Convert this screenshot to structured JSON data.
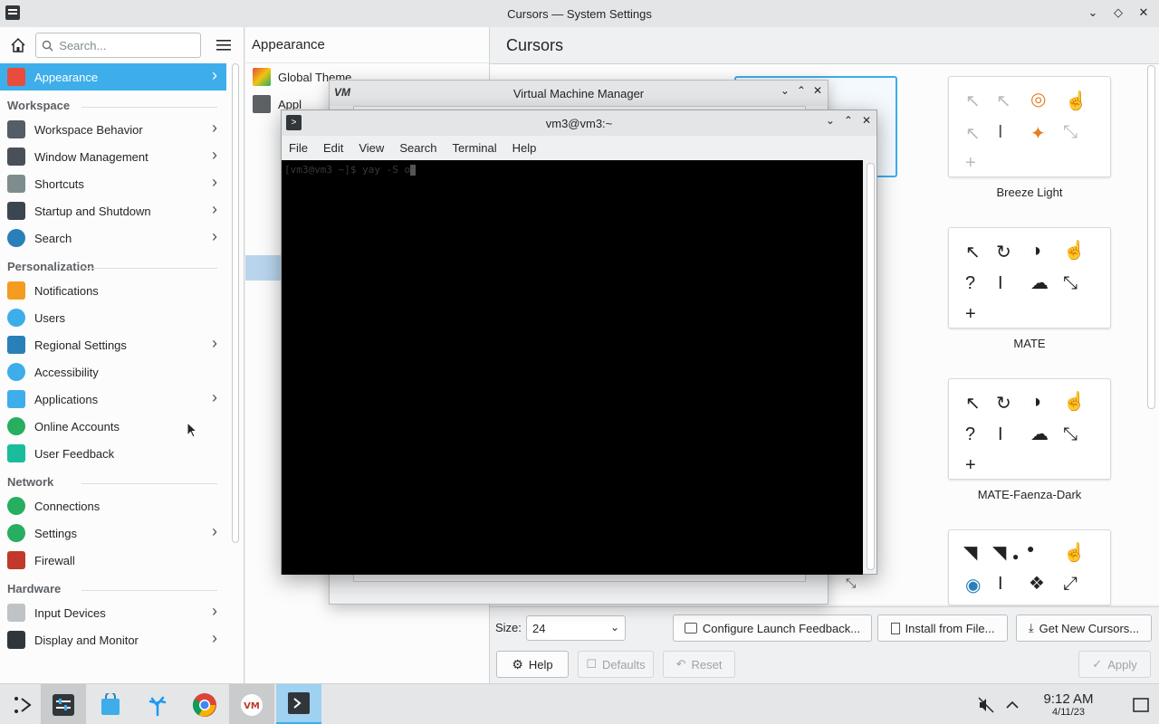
{
  "window": {
    "title": "Cursors — System Settings",
    "controls": [
      "chevron-down",
      "diamond",
      "close"
    ]
  },
  "sidebar": {
    "search_placeholder": "Search...",
    "active_item": "Appearance",
    "sections": [
      {
        "title": "",
        "items": [
          {
            "label": "Appearance",
            "icon": "appearance-icon",
            "color": "#e74c3c",
            "chevron": true
          }
        ]
      },
      {
        "title": "Workspace",
        "items": [
          {
            "label": "Workspace Behavior",
            "icon": "workspace-icon",
            "color": "#555d66",
            "chevron": true
          },
          {
            "label": "Window Management",
            "icon": "window-icon",
            "color": "#4a5058",
            "chevron": true
          },
          {
            "label": "Shortcuts",
            "icon": "keyboard-icon",
            "color": "#7f8c8d",
            "chevron": true
          },
          {
            "label": "Startup and Shutdown",
            "icon": "startup-icon",
            "color": "#3c4650",
            "chevron": true
          },
          {
            "label": "Search",
            "icon": "search-icon",
            "color": "#2980b9",
            "chevron": true
          }
        ]
      },
      {
        "title": "Personalization",
        "items": [
          {
            "label": "Notifications",
            "icon": "bell-icon",
            "color": "#f39c1f",
            "chevron": false
          },
          {
            "label": "Users",
            "icon": "users-icon",
            "color": "#3daee9",
            "chevron": false
          },
          {
            "label": "Regional Settings",
            "icon": "regional-icon",
            "color": "#2980b9",
            "chevron": true
          },
          {
            "label": "Accessibility",
            "icon": "accessibility-icon",
            "color": "#3daee9",
            "chevron": false
          },
          {
            "label": "Applications",
            "icon": "applications-icon",
            "color": "#3daee9",
            "chevron": true
          },
          {
            "label": "Online Accounts",
            "icon": "online-accounts-icon",
            "color": "#27ae60",
            "chevron": false
          },
          {
            "label": "User Feedback",
            "icon": "feedback-icon",
            "color": "#1abc9c",
            "chevron": false
          }
        ]
      },
      {
        "title": "Network",
        "items": [
          {
            "label": "Connections",
            "icon": "globe-icon",
            "color": "#27ae60",
            "chevron": false
          },
          {
            "label": "Settings",
            "icon": "globe-settings-icon",
            "color": "#27ae60",
            "chevron": true
          },
          {
            "label": "Firewall",
            "icon": "firewall-icon",
            "color": "#c0392b",
            "chevron": false
          }
        ]
      },
      {
        "title": "Hardware",
        "items": [
          {
            "label": "Input Devices",
            "icon": "mouse-icon",
            "color": "#bdc3c7",
            "chevron": true
          },
          {
            "label": "Display and Monitor",
            "icon": "monitor-icon",
            "color": "#31363b",
            "chevron": true
          }
        ]
      }
    ]
  },
  "middle": {
    "header": "Appearance",
    "items": [
      {
        "label": "Global Theme",
        "icon": "global-theme-icon"
      },
      {
        "label": "Appl",
        "icon": "application-style-icon"
      }
    ]
  },
  "right": {
    "header": "Cursors",
    "themes": [
      {
        "name": "Breeze Light",
        "style": "light"
      },
      {
        "name": "MATE",
        "style": "dark"
      },
      {
        "name": "MATE-Faenza-Dark",
        "style": "dark"
      },
      {
        "name": "",
        "style": "dark"
      }
    ],
    "size_label": "Size:",
    "size_value": "24",
    "buttons": {
      "configure": "Configure Launch Feedback...",
      "install": "Install from File...",
      "get_new": "Get New Cursors...",
      "help": "Help",
      "defaults": "Defaults",
      "reset": "Reset",
      "apply": "Apply"
    }
  },
  "vmm": {
    "title": "Virtual Machine Manager",
    "icon_text": "VM"
  },
  "terminal": {
    "title": "vm3@vm3:~",
    "menu": [
      "File",
      "Edit",
      "View",
      "Search",
      "Terminal",
      "Help"
    ],
    "prompt": "[vm3@vm3 ~]$ yay -S o"
  },
  "taskbar": {
    "time": "9:12 AM",
    "date": "4/11/23",
    "apps": [
      "application-launcher-icon",
      "system-settings-icon",
      "discover-icon",
      "dolphin-icon",
      "chrome-icon",
      "virt-manager-icon",
      "terminal-icon"
    ]
  }
}
